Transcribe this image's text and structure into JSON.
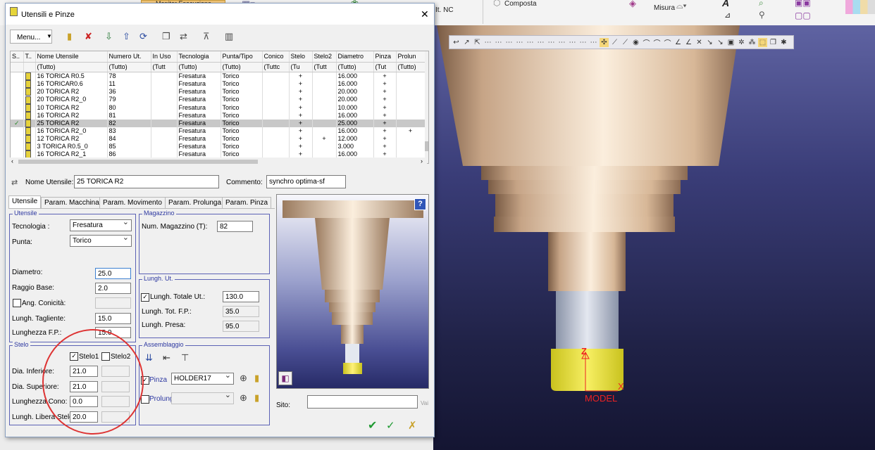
{
  "app": {
    "ribbon": {
      "monitor_label": "Monitor Esecuzione",
      "nc_label": "It. NC",
      "composta_label": "Composta",
      "misura_label": "Misura"
    },
    "viewport_label": "MODEL",
    "axis_z": "Z",
    "axis_x": "X"
  },
  "dialog": {
    "title": "Utensili e Pinze",
    "close_glyph": "✕",
    "menu_label": "Menu...",
    "columns": [
      "S..",
      "T..",
      "Nome Utensile",
      "Numero Ut.",
      "In Uso",
      "Tecnologia",
      "Punta/Tipo",
      "Conico",
      "Stelo",
      "Stelo2",
      "Diametro",
      "Pinza",
      "Prolun"
    ],
    "filters": [
      "",
      "",
      "(Tutto)",
      "(Tutto)",
      "(Tutt",
      "(Tutto)",
      "(Tutto)",
      "(Tuttc",
      "(Tu",
      "(Tutt",
      "(Tutto)",
      "(Tut",
      "(Tutto)"
    ],
    "rows": [
      {
        "check": "",
        "name": "16 TORICA R0.5",
        "num": "78",
        "tech": "Fresatura",
        "tipo": "Torico",
        "stelo": "+",
        "stelo2": "",
        "diam": "16.000",
        "pinza": "+",
        "prolun": ""
      },
      {
        "check": "",
        "name": "16 TORICAR0.6",
        "num": "11",
        "tech": "Fresatura",
        "tipo": "Torico",
        "stelo": "+",
        "stelo2": "",
        "diam": "16.000",
        "pinza": "+",
        "prolun": ""
      },
      {
        "check": "",
        "name": "20 TORICA R2",
        "num": "36",
        "tech": "Fresatura",
        "tipo": "Torico",
        "stelo": "+",
        "stelo2": "",
        "diam": "20.000",
        "pinza": "+",
        "prolun": ""
      },
      {
        "check": "",
        "name": "20 TORICA R2_0",
        "num": "79",
        "tech": "Fresatura",
        "tipo": "Torico",
        "stelo": "+",
        "stelo2": "",
        "diam": "20.000",
        "pinza": "+",
        "prolun": ""
      },
      {
        "check": "",
        "name": "10 TORICA R2",
        "num": "80",
        "tech": "Fresatura",
        "tipo": "Torico",
        "stelo": "+",
        "stelo2": "",
        "diam": "10.000",
        "pinza": "+",
        "prolun": ""
      },
      {
        "check": "",
        "name": "16 TORICA R2",
        "num": "81",
        "tech": "Fresatura",
        "tipo": "Torico",
        "stelo": "+",
        "stelo2": "",
        "diam": "16.000",
        "pinza": "+",
        "prolun": ""
      },
      {
        "check": "✓",
        "name": "25 TORICA R2",
        "num": "82",
        "tech": "Fresatura",
        "tipo": "Torico",
        "stelo": "+",
        "stelo2": "",
        "diam": "25.000",
        "pinza": "+",
        "prolun": "",
        "selected": true
      },
      {
        "check": "",
        "name": "16 TORICA R2_0",
        "num": "83",
        "tech": "Fresatura",
        "tipo": "Torico",
        "stelo": "+",
        "stelo2": "",
        "diam": "16.000",
        "pinza": "+",
        "prolun": "+"
      },
      {
        "check": "",
        "name": "12 TORICA R2",
        "num": "84",
        "tech": "Fresatura",
        "tipo": "Torico",
        "stelo": "+",
        "stelo2": "+",
        "diam": "12.000",
        "pinza": "+",
        "prolun": ""
      },
      {
        "check": "",
        "name": "3 TORICA R0.5_0",
        "num": "85",
        "tech": "Fresatura",
        "tipo": "Torico",
        "stelo": "+",
        "stelo2": "",
        "diam": "3.000",
        "pinza": "+",
        "prolun": ""
      },
      {
        "check": "",
        "name": "16 TORICA R2_1",
        "num": "86",
        "tech": "Fresatura",
        "tipo": "Torico",
        "stelo": "+",
        "stelo2": "",
        "diam": "16.000",
        "pinza": "+",
        "prolun": ""
      }
    ],
    "nome_utensile_label": "Nome Utensile:",
    "nome_utensile_value": "25 TORICA R2",
    "commento_label": "Commento:",
    "commento_value": "synchro optima-sf",
    "tabs": [
      "Utensile",
      "Param. Macchina",
      "Param. Movimento",
      "Param. Prolunga",
      "Param. Pinza"
    ],
    "utensile": {
      "group": "Utensile",
      "tecnologia_label": "Tecnologia :",
      "tecnologia_value": "Fresatura",
      "punta_label": "Punta:",
      "punta_value": "Torico",
      "diametro_label": "Diametro:",
      "diametro_value": "25.0",
      "raggio_label": "Raggio Base:",
      "raggio_value": "2.0",
      "conicita_label": "Ang. Conicità:",
      "tagliente_label": "Lungh. Tagliente:",
      "tagliente_value": "15.0",
      "fp_label": "Lunghezza F.P.:",
      "fp_value": "15.0"
    },
    "stelo": {
      "group": "Stelo",
      "stelo1_label": "Stelo1",
      "stelo2_label": "Stelo2",
      "dia_inf_label": "Dia. Inferiore:",
      "dia_inf_value": "21.0",
      "dia_sup_label": "Dia. Superiore:",
      "dia_sup_value": "21.0",
      "cono_label": "Lunghezza Cono:",
      "cono_value": "0.0",
      "libera_label": "Lungh. Libera Stelo:",
      "libera_value": "20.0"
    },
    "magazzino": {
      "group": "Magazzino",
      "num_label": "Num. Magazzino (T):",
      "num_value": "82"
    },
    "lungh": {
      "group": "Lungh. Ut.",
      "totale_label": "Lungh. Totale Ut.:",
      "totale_value": "130.0",
      "tot_fp_label": "Lungh. Tot. F.P.:",
      "tot_fp_value": "35.0",
      "presa_label": "Lungh. Presa:",
      "presa_value": "95.0"
    },
    "assemblaggio": {
      "group": "Assemblaggio",
      "pinza_label": "Pinza",
      "pinza_value": "HOLDER17",
      "prolunga_label": "Prolunga"
    },
    "sito_label": "Sito:",
    "vai_label": "Vai",
    "help_glyph": "?"
  }
}
